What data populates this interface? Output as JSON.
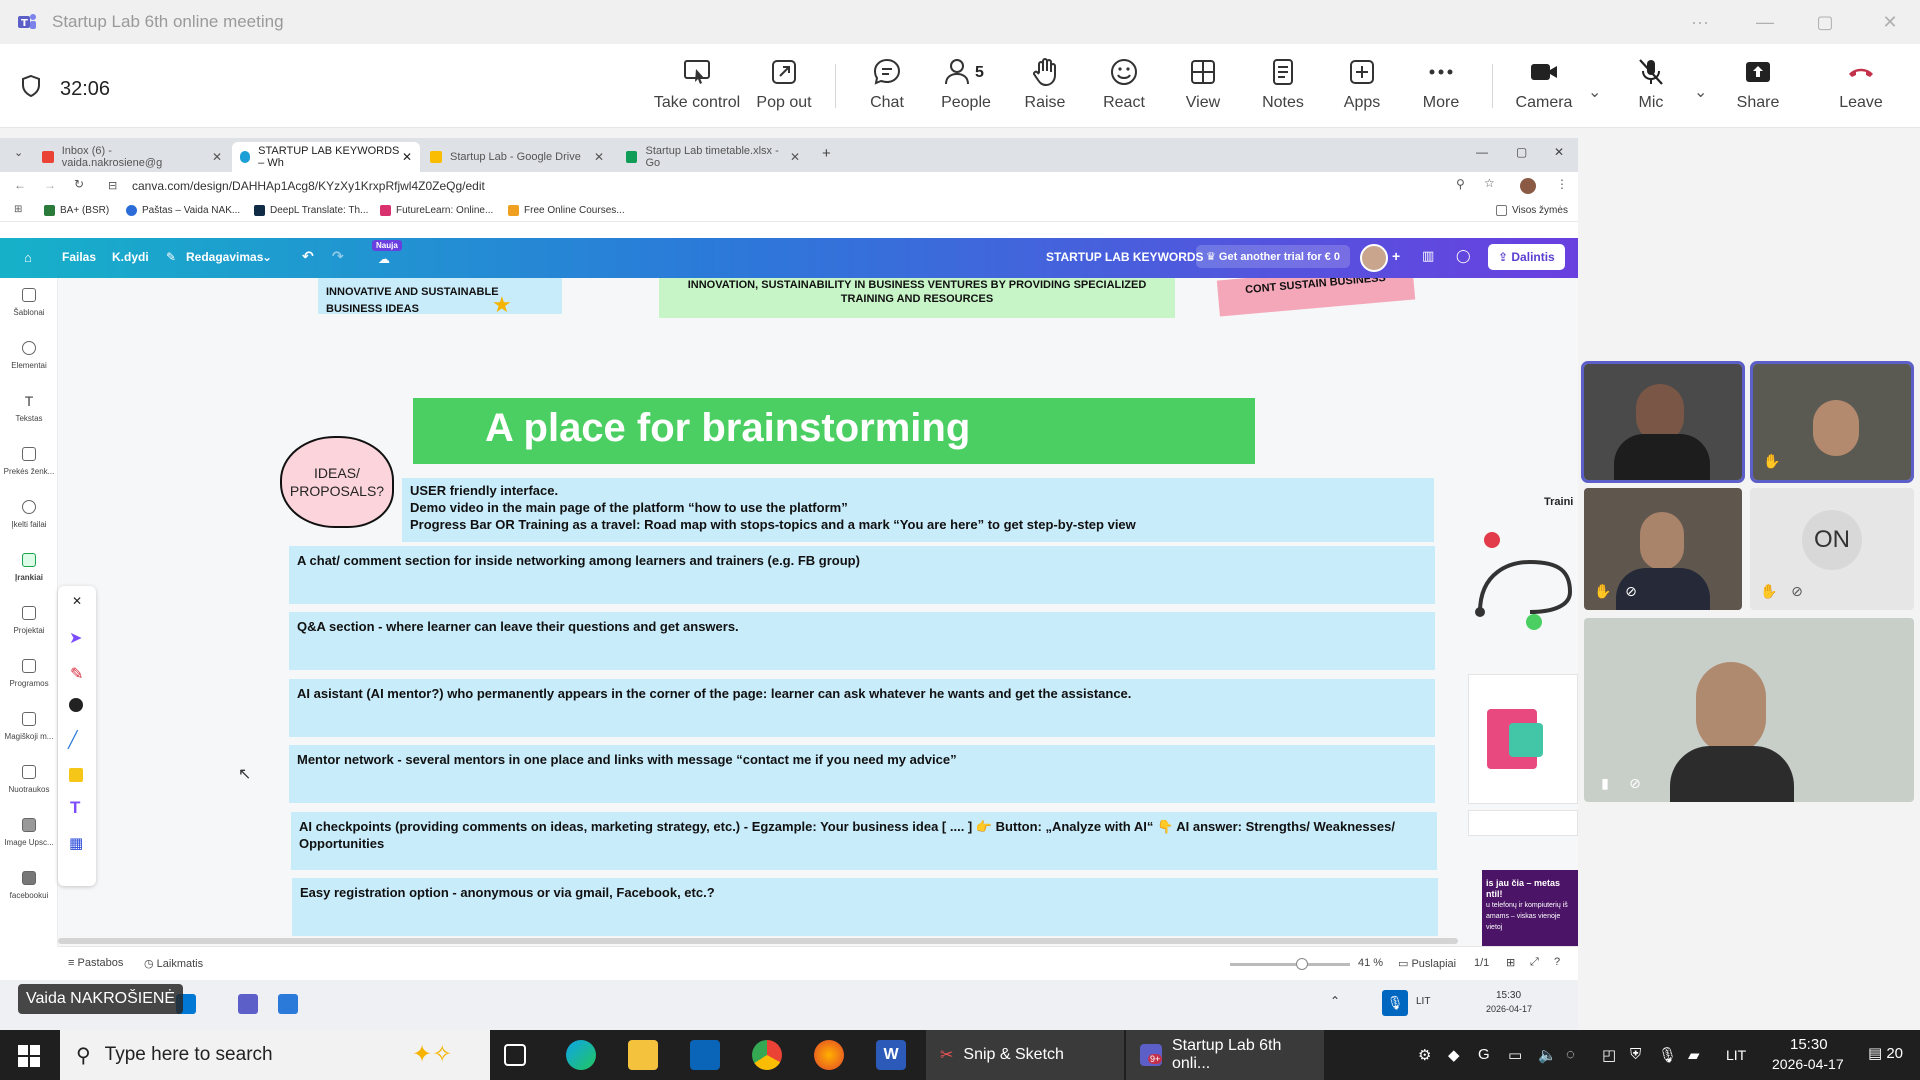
{
  "window": {
    "title": "Startup Lab 6th online meeting",
    "minimize": "—",
    "maximize": "▢",
    "close": "✕",
    "more": "···"
  },
  "meeting": {
    "timer": "32:06",
    "buttons": [
      {
        "label": "Take control"
      },
      {
        "label": "Pop out"
      },
      {
        "label": "Chat"
      },
      {
        "label": "People",
        "count": "5"
      },
      {
        "label": "Raise"
      },
      {
        "label": "React"
      },
      {
        "label": "View"
      },
      {
        "label": "Notes"
      },
      {
        "label": "Apps"
      },
      {
        "label": "More"
      },
      {
        "label": "Camera"
      },
      {
        "label": "Mic"
      },
      {
        "label": "Share"
      },
      {
        "label": "Leave"
      }
    ],
    "colors": {
      "accent": "#5b5fc7",
      "leave": "#c4314b"
    }
  },
  "browser": {
    "tabs": [
      {
        "label": "Inbox (6) - vaida.nakrosiene@g"
      },
      {
        "label": "STARTUP LAB KEYWORDS – Wh"
      },
      {
        "label": "Startup Lab - Google Drive"
      },
      {
        "label": "Startup Lab timetable.xlsx - Go"
      }
    ],
    "url": "canva.com/design/DAHHAp1Acg8/KYzXy1KrxpRfjwl4Z0ZeQg/edit",
    "bookmarks": [
      "BA+ (BSR)",
      "Paštas – Vaida NAK...",
      "DeepL Translate: Th...",
      "FutureLearn: Online...",
      "Free Online Courses..."
    ],
    "all_bookmarks": "Visos žymės"
  },
  "canva": {
    "menu": {
      "file": "Failas",
      "size": "K.dydi",
      "edit": "Redagavimas",
      "new_badge": "Nauja"
    },
    "doc_title": "STARTUP LAB KEYWORDS",
    "trial": "Get another trial for € 0",
    "share": "Dalintis",
    "sidebar": [
      "Šablonai",
      "Elementai",
      "Tekstas",
      "Prekės ženk...",
      "Įkelti failai",
      "Įrankiai",
      "Projektai",
      "Programos",
      "Magiškoji m...",
      "Nuotraukos",
      "Image Upsc...",
      "facebookui"
    ],
    "top_notes": {
      "left": "INNOVATIVE AND SUSTAINABLE BUSINESS IDEAS",
      "middle": "INNOVATION, SUSTAINABILITY IN BUSINESS VENTURES BY PROVIDING SPECIALIZED TRAINING AND RESOURCES",
      "right_a": "CONT",
      "right_b": "SUSTAIN BUSINESS"
    },
    "heading": "A place for brainstorming",
    "bubble": "IDEAS/ PROPOSALS?",
    "notes": [
      {
        "lines": [
          "USER friendly interface.",
          "Demo video in the main page of the platform “how to use the platform”",
          "Progress Bar OR Training as a travel: Road map with stops-topics and a mark “You are here” to get step-by-step view"
        ]
      },
      {
        "lines": [
          "A chat/ comment section for inside networking among learners and trainers (e.g. FB group)"
        ]
      },
      {
        "lines": [
          "Q&A section - where learner can leave their questions and get answers."
        ]
      },
      {
        "lines": [
          "AI asistant (AI mentor?) who permanently appears in the corner of the page: learner can ask whatever he wants and get the assistance."
        ]
      },
      {
        "lines": [
          "Mentor network - several mentors in one place and links with message “contact me if you need my advice”"
        ]
      },
      {
        "lines": [
          "AI checkpoints (providing comments on ideas, marketing strategy, etc.) - Egzample: Your business idea  [ .... ] 👉 Button: „Analyze with AI“ 👇  AI answer: Strengths/ Weaknesses/ Opportunities"
        ]
      },
      {
        "lines": [
          "Easy registration option - anonymous or via gmail, Facebook, etc.?"
        ]
      }
    ],
    "right_peek": {
      "label": "Traini",
      "promo_a": "is jau čia – metas",
      "promo_b": "ntil!",
      "promo_c": "u telefonų ir kompiuterių iš",
      "promo_d": "amams – viskas vienoje vietoj"
    },
    "bottom": {
      "notes": "Pastabos",
      "timer": "Laikmatis",
      "zoom": "41 %",
      "pages": "Puslapiai",
      "page_count": "1/1"
    }
  },
  "shared_taskbar": {
    "time": "15:30",
    "date": "2026-04-17",
    "lang": "LIT"
  },
  "presenter_name": "Vaida NAKROŠIENĖ",
  "participants": [
    {
      "name": "participant-1"
    },
    {
      "name": "participant-2"
    },
    {
      "name": "participant-3"
    },
    {
      "initials": "ON"
    },
    {
      "name": "participant-5"
    }
  ],
  "windows": {
    "search_placeholder": "Type here to search",
    "apps": [
      "Snip & Sketch",
      "Startup Lab 6th onli..."
    ],
    "teams_badge": "9+",
    "time": "15:30",
    "date": "2026-04-17",
    "lang": "LIT",
    "notif": "20"
  }
}
